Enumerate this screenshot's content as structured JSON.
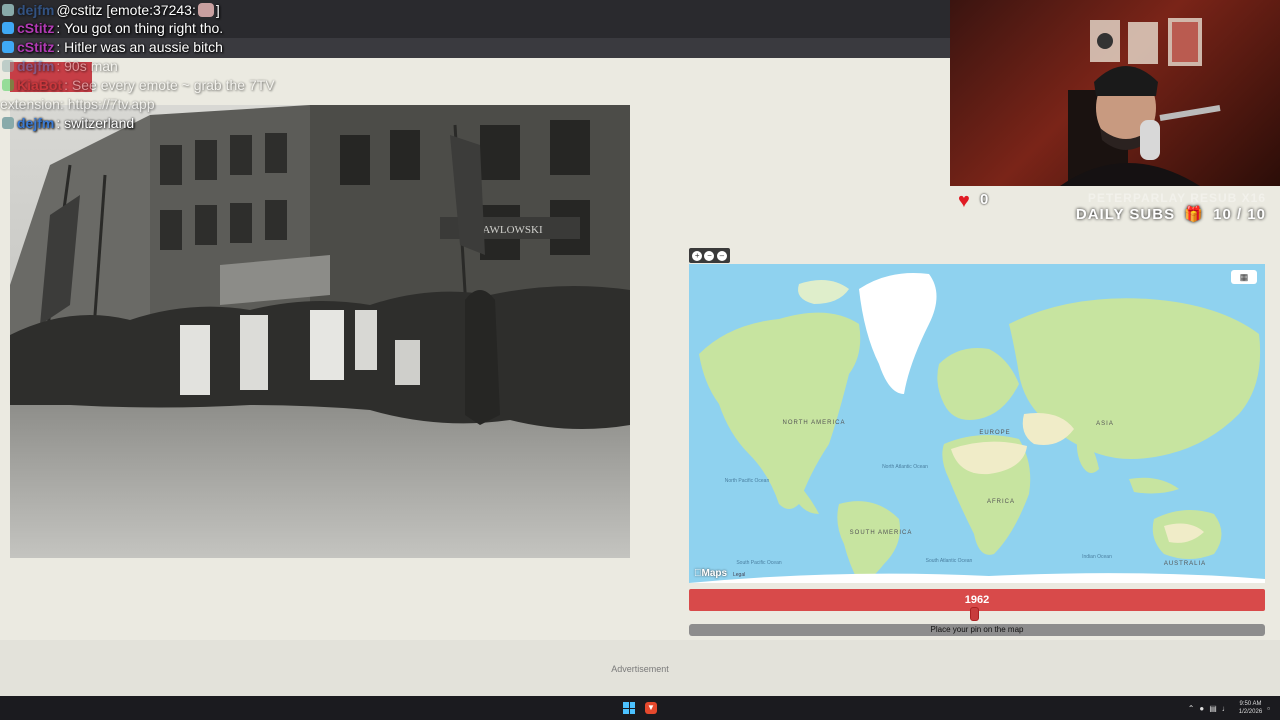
{
  "chat": {
    "messages": [
      {
        "user": "dejfm",
        "color": "#3a7bd5",
        "text": "@cstitz [emote:37243:",
        "suffix": "]",
        "faded": false
      },
      {
        "user": "cStitz",
        "color": "#b23bb5",
        "text": "You got on thing right tho.",
        "suffix": "",
        "faded": false
      },
      {
        "user": "cStitz",
        "color": "#b23bb5",
        "text": "Hitler was an aussie bitch",
        "suffix": "",
        "faded": false
      },
      {
        "user": "dejfm",
        "color": "#3a7bd5",
        "text": "90s man",
        "suffix": "",
        "faded": true
      },
      {
        "user": "KiaBot",
        "color": "#d03030",
        "text": "See every emote ~ grab the 7TV",
        "suffix": "",
        "faded": true
      },
      {
        "user": "",
        "color": "#ffffff",
        "text": "extension: https://7tv.app",
        "suffix": "",
        "faded": true
      },
      {
        "user": "dejfm",
        "color": "#3a7bd5",
        "text": "switzerland",
        "suffix": "",
        "faded": false
      }
    ]
  },
  "photo": {
    "sign_text": "PAWLOWSKI"
  },
  "stream": {
    "heart_count": "0",
    "resub_text": "PETERPARLAY RESUB X16",
    "daily_subs_label": "DAILY SUBS",
    "daily_subs_value": "10 / 10"
  },
  "map": {
    "tools_icons": [
      "zoom-in-icon",
      "zoom-out-icon",
      "minimize-icon"
    ],
    "labels": {
      "north_america": "NORTH AMERICA",
      "south_america": "SOUTH AMERICA",
      "europe": "EUROPE",
      "asia": "ASIA",
      "africa": "AFRICA",
      "australia": "AUSTRALIA",
      "north_atlantic": "North Atlantic Ocean",
      "north_pacific": "North Pacific Ocean",
      "south_pacific": "South Pacific Ocean",
      "south_atlantic": "South Atlantic Ocean",
      "indian": "Indian Ocean"
    },
    "attribution": "Maps",
    "legal": "Legal",
    "colors": {
      "water": "#8fd2ef",
      "land": "#c7e4a0",
      "desert": "#f0ecc8",
      "ice": "#ffffff"
    }
  },
  "game": {
    "year": "1962",
    "place_pin_label": "Place your pin on the map",
    "accent": "#d84a4a"
  },
  "advertisement_label": "Advertisement",
  "taskbar": {
    "time": "9:50 AM",
    "date": "1/2/2026",
    "tray_icons": [
      "chevron-up-icon",
      "mic-icon",
      "network-icon",
      "volume-icon",
      "notification-icon"
    ]
  }
}
